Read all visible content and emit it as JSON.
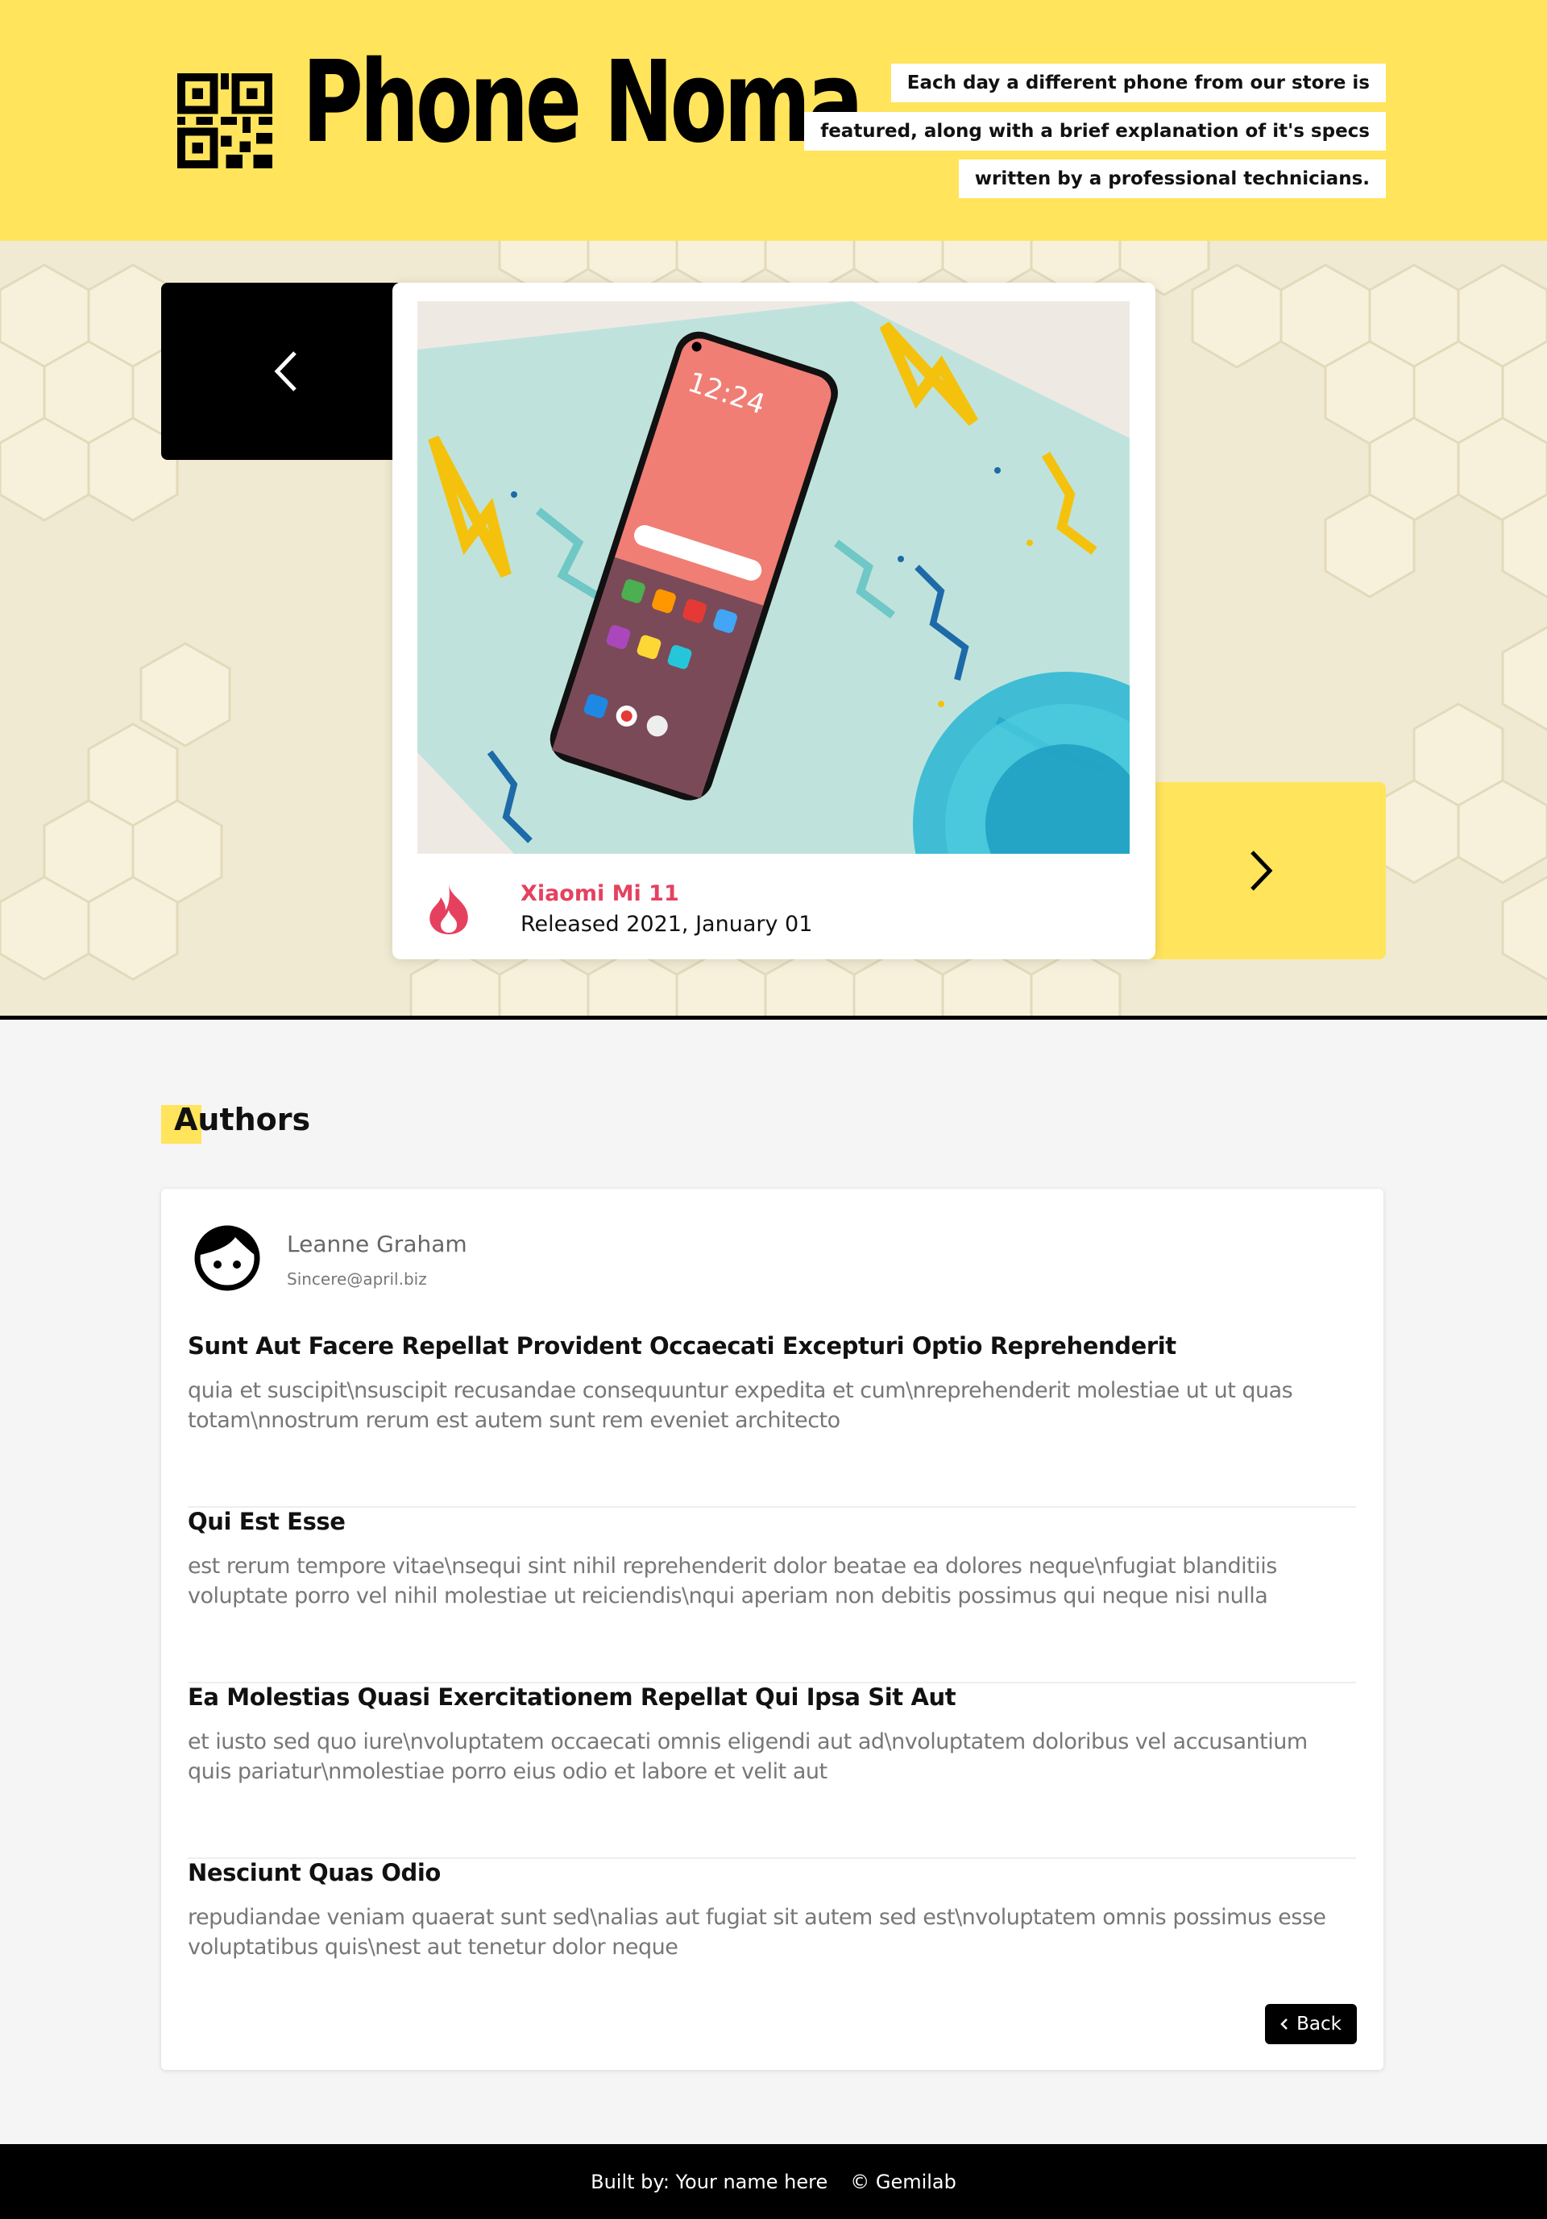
{
  "header": {
    "brand": "Phone Noma",
    "tagline": [
      "Each day a different phone from our store is",
      "featured, along with a brief explanation of it's specs",
      "written by a professional technicians."
    ],
    "qr_icon": "qr-code-icon"
  },
  "featured": {
    "name": "Xiaomi Mi 11",
    "release": "Released 2021, January 01",
    "prev_icon": "chevron-left-icon",
    "next_icon": "chevron-right-icon",
    "badge_icon": "fire-icon",
    "phone_time": "12:24"
  },
  "authors": {
    "title": "Authors",
    "author": {
      "name": "Leanne Graham",
      "email": "Sincere@april.biz"
    },
    "posts": [
      {
        "title": "Sunt Aut Facere Repellat Provident Occaecati Excepturi Optio Reprehenderit",
        "body": "quia et suscipit\\nsuscipit recusandae consequuntur expedita et cum\\nreprehenderit molestiae ut ut quas totam\\nnostrum rerum est autem sunt rem eveniet architecto"
      },
      {
        "title": "Qui Est Esse",
        "body": "est rerum tempore vitae\\nsequi sint nihil reprehenderit dolor beatae ea dolores neque\\nfugiat blanditiis voluptate porro vel nihil molestiae ut reiciendis\\nqui aperiam non debitis possimus qui neque nisi nulla"
      },
      {
        "title": "Ea Molestias Quasi Exercitationem Repellat Qui Ipsa Sit Aut",
        "body": "et iusto sed quo iure\\nvoluptatem occaecati omnis eligendi aut ad\\nvoluptatem doloribus vel accusantium quis pariatur\\nmolestiae porro eius odio et labore et velit aut"
      },
      {
        "title": "Nesciunt Quas Odio",
        "body": "repudiandae veniam quaerat sunt sed\\nalias aut fugiat sit autem sed est\\nvoluptatem omnis possimus esse voluptatibus quis\\nest aut tenetur dolor neque"
      }
    ],
    "back_label": "Back"
  },
  "footer": {
    "built_by": "Built by: Your name here",
    "copyright": "© Gemilab"
  },
  "colors": {
    "accent": "#ffe45c",
    "brand_text": "#000000",
    "phone_name": "#e5415f",
    "footer_bg": "#000000"
  }
}
